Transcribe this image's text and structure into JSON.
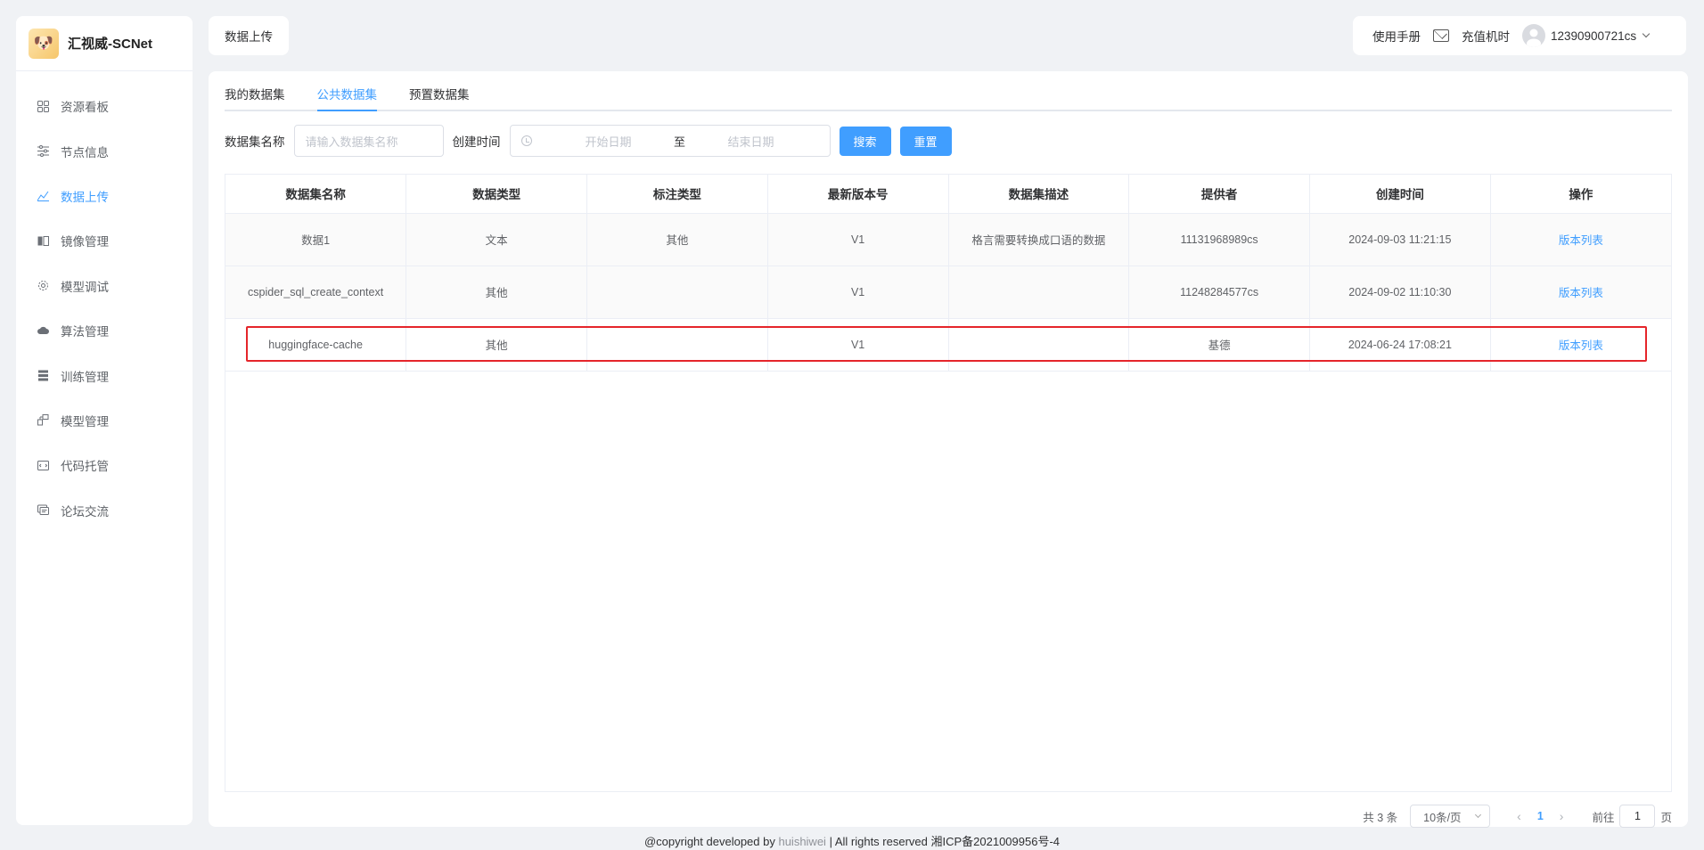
{
  "brand": {
    "name": "汇视威-SCNet",
    "logo_icon": "dog-mascot-icon"
  },
  "sidebar": {
    "items": [
      {
        "label": "资源看板",
        "icon": "grid-icon",
        "active": false
      },
      {
        "label": "节点信息",
        "icon": "sliders-icon",
        "active": false
      },
      {
        "label": "数据上传",
        "icon": "chart-icon",
        "active": true
      },
      {
        "label": "镜像管理",
        "icon": "layers-icon",
        "active": false
      },
      {
        "label": "模型调试",
        "icon": "gear-icon",
        "active": false
      },
      {
        "label": "算法管理",
        "icon": "cloud-icon",
        "active": false
      },
      {
        "label": "训练管理",
        "icon": "stack-icon",
        "active": false
      },
      {
        "label": "模型管理",
        "icon": "model-icon",
        "active": false
      },
      {
        "label": "代码托管",
        "icon": "code-icon",
        "active": false
      },
      {
        "label": "论坛交流",
        "icon": "chat-icon",
        "active": false
      }
    ]
  },
  "header": {
    "breadcrumb": "数据上传",
    "manual": "使用手册",
    "recharge": "充值机时",
    "username": "12390900721cs"
  },
  "tabs": [
    {
      "label": "我的数据集",
      "active": false
    },
    {
      "label": "公共数据集",
      "active": true
    },
    {
      "label": "预置数据集",
      "active": false
    }
  ],
  "filters": {
    "name_label": "数据集名称",
    "name_placeholder": "请输入数据集名称",
    "time_label": "创建时间",
    "start_placeholder": "开始日期",
    "to": "至",
    "end_placeholder": "结束日期",
    "search_button": "搜索",
    "reset_button": "重置"
  },
  "table": {
    "columns": [
      "数据集名称",
      "数据类型",
      "标注类型",
      "最新版本号",
      "数据集描述",
      "提供者",
      "创建时间",
      "操作"
    ],
    "rows": [
      {
        "name": "数据1",
        "type": "文本",
        "label_type": "其他",
        "version": "V1",
        "desc": "格言需要转换成口语的数据",
        "provider": "11131968989cs",
        "created": "2024-09-03 11:21:15",
        "action": "版本列表"
      },
      {
        "name": "cspider_sql_create_context",
        "type": "其他",
        "label_type": "",
        "version": "V1",
        "desc": "",
        "provider": "11248284577cs",
        "created": "2024-09-02 11:10:30",
        "action": "版本列表"
      },
      {
        "name": "huggingface-cache",
        "type": "其他",
        "label_type": "",
        "version": "V1",
        "desc": "",
        "provider": "基德",
        "created": "2024-06-24 17:08:21",
        "action": "版本列表"
      }
    ]
  },
  "pagination": {
    "total": "共 3 条",
    "page_size": "10条/页",
    "current_page": "1",
    "goto_label": "前往",
    "goto_value": "1",
    "goto_suffix": "页"
  },
  "footer": {
    "prefix": "@copyright developed by ",
    "link": "huishiwei",
    "suffix": " | All rights reserved 湘ICP备2021009956号-4"
  },
  "colors": {
    "accent": "#409eff",
    "highlight": "#e5252a"
  }
}
